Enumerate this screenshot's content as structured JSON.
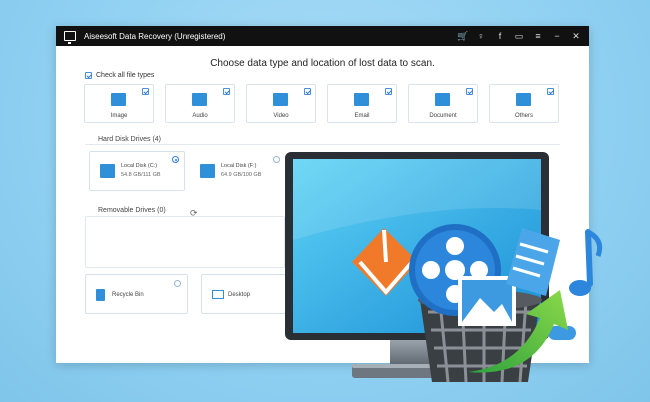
{
  "window": {
    "title": "Aiseesoft Data Recovery (Unregistered)",
    "icons": [
      "cart-icon",
      "key-icon",
      "facebook-icon",
      "chat-icon",
      "menu-icon",
      "minimize-icon",
      "close-icon"
    ],
    "icon_glyphs": [
      "🛒",
      "♀",
      "f",
      "▭",
      "≡",
      "−",
      "✕"
    ]
  },
  "heading": "Choose data type and location of lost data to scan.",
  "check_all_label": "Check all file types",
  "file_types": [
    {
      "label": "Image",
      "checked": true
    },
    {
      "label": "Audio",
      "checked": true
    },
    {
      "label": "Video",
      "checked": true
    },
    {
      "label": "Email",
      "checked": true
    },
    {
      "label": "Document",
      "checked": true
    },
    {
      "label": "Others",
      "checked": true
    }
  ],
  "hard_disk": {
    "label": "Hard Disk Drives (4)",
    "disks": [
      {
        "name": "Local Disk (C:)",
        "size": "54.8 GB/111 GB",
        "selected": true
      },
      {
        "name": "Local Disk (F:)",
        "size": "64.9 GB/100 GB",
        "selected": false
      }
    ]
  },
  "removable": {
    "label": "Removable Drives (0)"
  },
  "locations": [
    {
      "label": "Recycle Bin"
    },
    {
      "label": "Desktop"
    }
  ],
  "colors": {
    "accent": "#2f8fd8",
    "background": "#8fd0f2",
    "titlebar": "#111111"
  }
}
